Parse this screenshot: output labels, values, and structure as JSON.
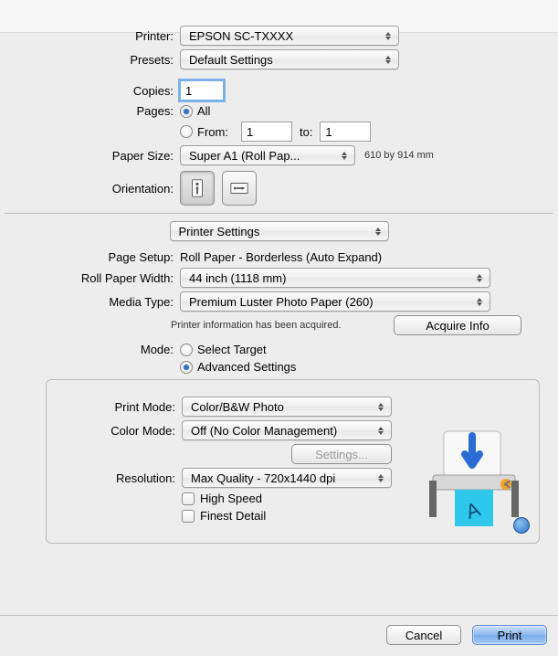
{
  "header": {
    "printer_label": "Printer:",
    "printer_value": "EPSON SC-TXXXX",
    "presets_label": "Presets:",
    "presets_value": "Default Settings"
  },
  "copies": {
    "label": "Copies:",
    "value": "1"
  },
  "pages": {
    "label": "Pages:",
    "all_label": "All",
    "from_label": "From:",
    "from_value": "1",
    "to_label": "to:",
    "to_value": "1",
    "selected": "all"
  },
  "paper_size": {
    "label": "Paper Size:",
    "value": "Super A1 (Roll Pap...",
    "dims": "610 by 914 mm"
  },
  "orientation": {
    "label": "Orientation:"
  },
  "panel_select": "Printer Settings",
  "page_setup": {
    "label": "Page Setup:",
    "value": "Roll Paper - Borderless (Auto Expand)"
  },
  "roll_width": {
    "label": "Roll Paper Width:",
    "value": "44 inch (1118 mm)"
  },
  "media_type": {
    "label": "Media Type:",
    "value": "Premium Luster Photo Paper (260)"
  },
  "acquire": {
    "info_text": "Printer information has been acquired.",
    "button": "Acquire Info"
  },
  "mode": {
    "label": "Mode:",
    "select_target": "Select Target",
    "advanced": "Advanced Settings",
    "selected": "advanced"
  },
  "advanced": {
    "print_mode_label": "Print Mode:",
    "print_mode_value": "Color/B&W Photo",
    "color_mode_label": "Color Mode:",
    "color_mode_value": "Off (No Color Management)",
    "settings_button": "Settings...",
    "resolution_label": "Resolution:",
    "resolution_value": "Max Quality - 720x1440 dpi",
    "high_speed": "High Speed",
    "finest_detail": "Finest Detail"
  },
  "footer": {
    "cancel": "Cancel",
    "print": "Print"
  }
}
